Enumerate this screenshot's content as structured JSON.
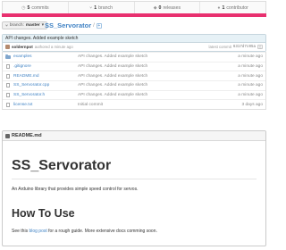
{
  "stats": [
    {
      "icon": "commits-icon",
      "count": "5",
      "label": "commits"
    },
    {
      "icon": "branch-icon",
      "count": "1",
      "label": "branch"
    },
    {
      "icon": "releases-icon",
      "count": "0",
      "label": "releases"
    },
    {
      "icon": "contributors-icon",
      "count": "1",
      "label": "contributor"
    }
  ],
  "colors": {
    "language_bar": "#e8306f",
    "link": "#4183c4",
    "commit_bg": "#e6f1f6"
  },
  "branch": {
    "prefix": "branch:",
    "name": "master",
    "caret": "▾"
  },
  "repo": {
    "name": "SS_Servorator",
    "sep": "/",
    "plus": "+"
  },
  "commit": {
    "message": "API changes. Added example sketch",
    "author": "soldernpot",
    "time": "authored a minute ago",
    "latest_label": "latest commit",
    "sha": "6317d7c05a"
  },
  "files": [
    {
      "type": "folder",
      "name": "examples",
      "message": "API changes. Added example sketch",
      "age": "a minute ago"
    },
    {
      "type": "file",
      "name": ".gitignore",
      "message": "API changes. Added example sketch",
      "age": "a minute ago"
    },
    {
      "type": "file",
      "name": "README.md",
      "message": "API changes. Added example sketch",
      "age": "a minute ago"
    },
    {
      "type": "file",
      "name": "SS_Servorator.cpp",
      "message": "API changes. Added example sketch",
      "age": "a minute ago"
    },
    {
      "type": "file",
      "name": "SS_Servorator.h",
      "message": "API changes. Added example sketch",
      "age": "a minute ago"
    },
    {
      "type": "file",
      "name": "license.txt",
      "message": "Initial commit",
      "age": "3 days ago"
    }
  ],
  "readme": {
    "header": "README.md",
    "h1": "SS_Servorator",
    "p1": "An Arduino library that provides simple speed control for servos.",
    "h2": "How To Use",
    "p2_before": "See this",
    "p2_link": "blog post",
    "p2_after": "for a rough guide. More extensive docs comming soon."
  }
}
